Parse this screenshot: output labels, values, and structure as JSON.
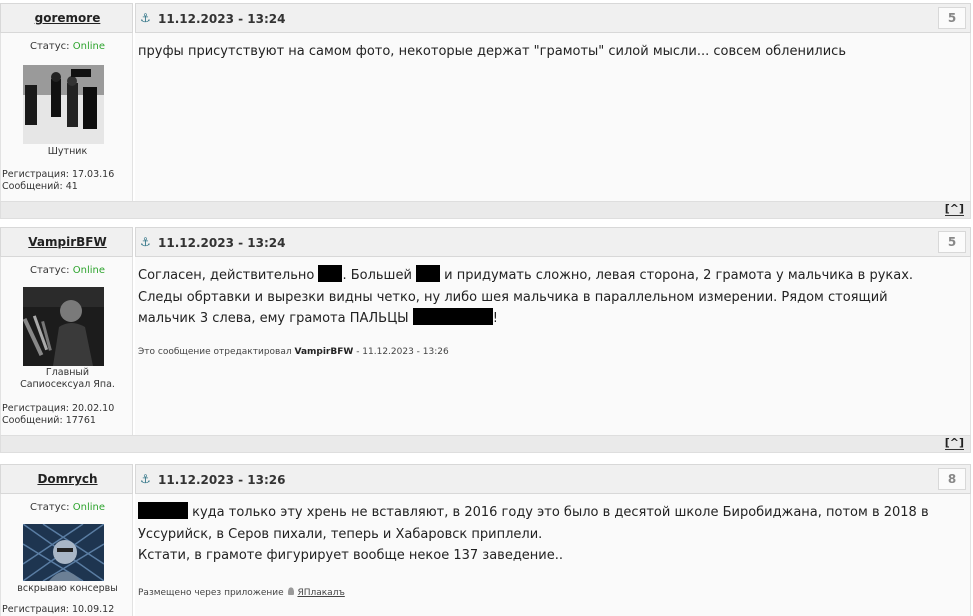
{
  "posts": [
    {
      "username": "goremore",
      "status_label": "Статус:",
      "status_value": "Online",
      "user_title": "Шутник",
      "reg_label": "Регистрация:",
      "reg_date": "17.03.16",
      "msgs_label": "Сообщений:",
      "msgs_count": "41",
      "date": "11.12.2023 - 13:24",
      "vote": "5",
      "text": "пруфы присутствуют на самом фото, некоторые держат \"грамоты\" силой мысли... совсем обленились",
      "up": "[^]"
    },
    {
      "username": "VampirBFW",
      "status_label": "Статус:",
      "status_value": "Online",
      "user_title": "Главный Сапиосексуал Япа.",
      "reg_label": "Регистрация:",
      "reg_date": "20.02.10",
      "msgs_label": "Сообщений:",
      "msgs_count": "17761",
      "date": "11.12.2023 - 13:24",
      "vote": "5",
      "text_parts": [
        "Согласен, действительно ",
        ". Большей ",
        " и придумать сложно, левая сторона, 2 грамота у мальчика в руках. Следы обртавки и вырезки видны четко, ну либо шея мальчика в параллельном измерении. Рядом стоящий мальчик 3 слева, ему грамота ПАЛЬЦЫ ",
        "!"
      ],
      "edit_note_prefix": "Это сообщение отредактировал",
      "edit_note_user": "VampirBFW",
      "edit_note_suffix": "- 11.12.2023 - 13:26",
      "up": "[^]"
    },
    {
      "username": "Domrych",
      "status_label": "Статус:",
      "status_value": "Online",
      "user_title": "вскрываю консервы",
      "reg_label": "Регистрация:",
      "reg_date": "10.09.12",
      "date": "11.12.2023 - 13:26",
      "vote": "8",
      "text_line1": " куда только эту хрень не вставляют, в 2016 году это было в десятой школе Биробиджана, потом в 2018 в Уссурийск, в Серов пихали, теперь и Хабаровск приплели.",
      "text_line2": "Кстати, в грамоте фигурирует вообще некое 137 заведение..",
      "posted_via": "Размещено через приложение",
      "app_name": "ЯПлакалъ"
    }
  ],
  "colors": {
    "online": "#2ea42e",
    "anchor": "#3a7a8c",
    "header_bg": "#f0f0f0",
    "body_bg": "#fafafa"
  },
  "icons": {
    "post_anchor": "anchor-icon",
    "app": "android-icon"
  }
}
